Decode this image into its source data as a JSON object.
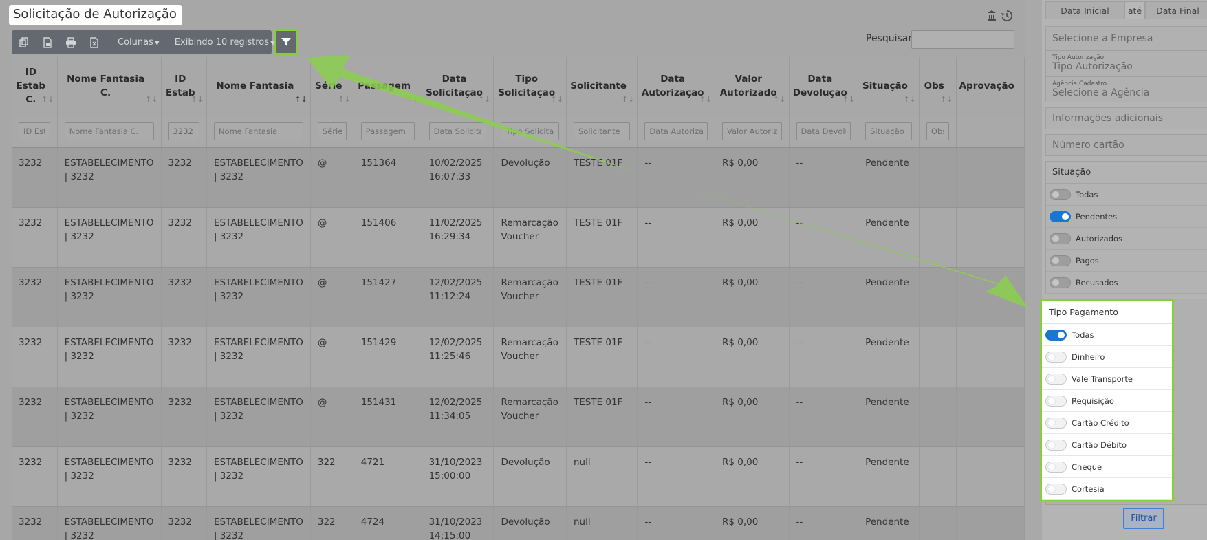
{
  "page": {
    "title": "Solicitação de Autorização"
  },
  "toolbar": {
    "columns_label": "Colunas",
    "records_label": "Exibindo 10 registros",
    "search_label": "Pesquisar",
    "search_value": ""
  },
  "table": {
    "headers": [
      {
        "label": "ID\nEstab\nC."
      },
      {
        "label": "Nome Fantasia\nC."
      },
      {
        "label": "ID\nEstab"
      },
      {
        "label": "Nome Fantasia"
      },
      {
        "label": "Série"
      },
      {
        "label": "Passagem"
      },
      {
        "label": "Data\nSolicitação"
      },
      {
        "label": "Tipo\nSolicitação"
      },
      {
        "label": "Solicitante"
      },
      {
        "label": "Data\nAutorização"
      },
      {
        "label": "Valor\nAutorizado"
      },
      {
        "label": "Data\nDevolução"
      },
      {
        "label": "Situação"
      },
      {
        "label": "Obs"
      },
      {
        "label": "Aprovação"
      }
    ],
    "filters": [
      {
        "placeholder": "ID Estab C.",
        "value": ""
      },
      {
        "placeholder": "Nome Fantasia C.",
        "value": ""
      },
      {
        "placeholder": "ID Estab",
        "value": "3232"
      },
      {
        "placeholder": "Nome Fantasia",
        "value": ""
      },
      {
        "placeholder": "Série",
        "value": ""
      },
      {
        "placeholder": "Passagem",
        "value": ""
      },
      {
        "placeholder": "Data Solicitação",
        "value": ""
      },
      {
        "placeholder": "Tipo Solicitação",
        "value": ""
      },
      {
        "placeholder": "Solicitante",
        "value": ""
      },
      {
        "placeholder": "Data Autorização",
        "value": ""
      },
      {
        "placeholder": "Valor Autorizado",
        "value": ""
      },
      {
        "placeholder": "Data Devolução",
        "value": ""
      },
      {
        "placeholder": "Situação",
        "value": ""
      },
      {
        "placeholder": "Obs",
        "value": ""
      }
    ],
    "rows": [
      [
        "3232",
        "ESTABELECIMENTO\n| 3232",
        "3232",
        "ESTABELECIMENTO\n| 3232",
        "@",
        "151364",
        "10/02/2025\n16:07:33",
        "Devolução",
        "TESTE 01F",
        "--",
        "R$ 0,00",
        "--",
        "Pendente",
        "",
        ""
      ],
      [
        "3232",
        "ESTABELECIMENTO\n| 3232",
        "3232",
        "ESTABELECIMENTO\n| 3232",
        "@",
        "151406",
        "11/02/2025\n16:29:34",
        "Remarcação\nVoucher",
        "TESTE 01F",
        "--",
        "R$ 0,00",
        "--",
        "Pendente",
        "",
        ""
      ],
      [
        "3232",
        "ESTABELECIMENTO\n| 3232",
        "3232",
        "ESTABELECIMENTO\n| 3232",
        "@",
        "151427",
        "12/02/2025\n11:12:24",
        "Remarcação\nVoucher",
        "TESTE 01F",
        "--",
        "R$ 0,00",
        "--",
        "Pendente",
        "",
        ""
      ],
      [
        "3232",
        "ESTABELECIMENTO\n| 3232",
        "3232",
        "ESTABELECIMENTO\n| 3232",
        "@",
        "151429",
        "12/02/2025\n11:25:46",
        "Remarcação\nVoucher",
        "TESTE 01F",
        "--",
        "R$ 0,00",
        "--",
        "Pendente",
        "",
        ""
      ],
      [
        "3232",
        "ESTABELECIMENTO\n| 3232",
        "3232",
        "ESTABELECIMENTO\n| 3232",
        "@",
        "151431",
        "12/02/2025\n11:34:05",
        "Remarcação\nVoucher",
        "TESTE 01F",
        "--",
        "R$ 0,00",
        "--",
        "Pendente",
        "",
        ""
      ],
      [
        "3232",
        "ESTABELECIMENTO\n| 3232",
        "3232",
        "ESTABELECIMENTO\n| 3232",
        "322",
        "4721",
        "31/10/2023\n15:00:00",
        "Devolução",
        "null",
        "--",
        "R$ 0,00",
        "--",
        "Pendente",
        "",
        ""
      ],
      [
        "3232",
        "ESTABELECIMENTO\n| 3232",
        "3232",
        "ESTABELECIMENTO\n| 3232",
        "322",
        "4724",
        "31/10/2023\n14:15:00",
        "Devolução",
        "null",
        "--",
        "R$ 0,00",
        "--",
        "Pendente",
        "",
        ""
      ]
    ]
  },
  "panel": {
    "date_start": "Data Inicial",
    "date_sep": "até",
    "date_end": "Data Final",
    "empresa_placeholder": "Selecione a Empresa",
    "tipo_autorizacao_label": "Tipo Autorização",
    "tipo_autorizacao_placeholder": "Tipo Autorização",
    "agencia_label": "Agência Cadastro",
    "agencia_placeholder": "Selecione a Agência",
    "info_placeholder": "Informações adicionais",
    "cartao_placeholder": "Número cartão",
    "situacao": {
      "title": "Situação",
      "options": [
        {
          "label": "Todas",
          "on": false
        },
        {
          "label": "Pendentes",
          "on": true
        },
        {
          "label": "Autorizados",
          "on": false
        },
        {
          "label": "Pagos",
          "on": false
        },
        {
          "label": "Recusados",
          "on": false
        }
      ]
    },
    "tipo_pagamento": {
      "title": "Tipo Pagamento",
      "options": [
        {
          "label": "Todas",
          "on": true
        },
        {
          "label": "Dinheiro",
          "on": false
        },
        {
          "label": "Vale Transporte",
          "on": false
        },
        {
          "label": "Requisição",
          "on": false
        },
        {
          "label": "Cartão Crédito",
          "on": false
        },
        {
          "label": "Cartão Débito",
          "on": false
        },
        {
          "label": "Cheque",
          "on": false
        },
        {
          "label": "Cortesia",
          "on": false
        }
      ]
    },
    "filter_button": "Filtrar"
  },
  "colors": {
    "highlight": "#86cf3c",
    "accent": "#1976d2"
  }
}
